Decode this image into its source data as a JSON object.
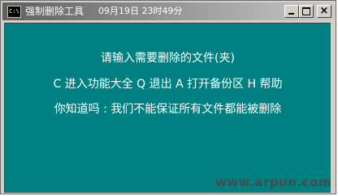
{
  "window": {
    "icon_text": "C:\\",
    "title": "强制删除工具",
    "datetime": "09月19日 23时49分",
    "min_label": "",
    "max_label": "",
    "close_label": "×"
  },
  "console": {
    "lines": [
      "请输入需要删除的文件(夹)",
      "C 进入功能大全 Q 退出 A 打开备份区 H 帮助",
      "你知道吗 : 我们不能保证所有文件都能被删除"
    ]
  },
  "watermark": "www.arpun.com",
  "colors": {
    "console_bg": "#008080",
    "console_text": "#ffffff",
    "title_gradient_start": "#5f5f5f"
  }
}
